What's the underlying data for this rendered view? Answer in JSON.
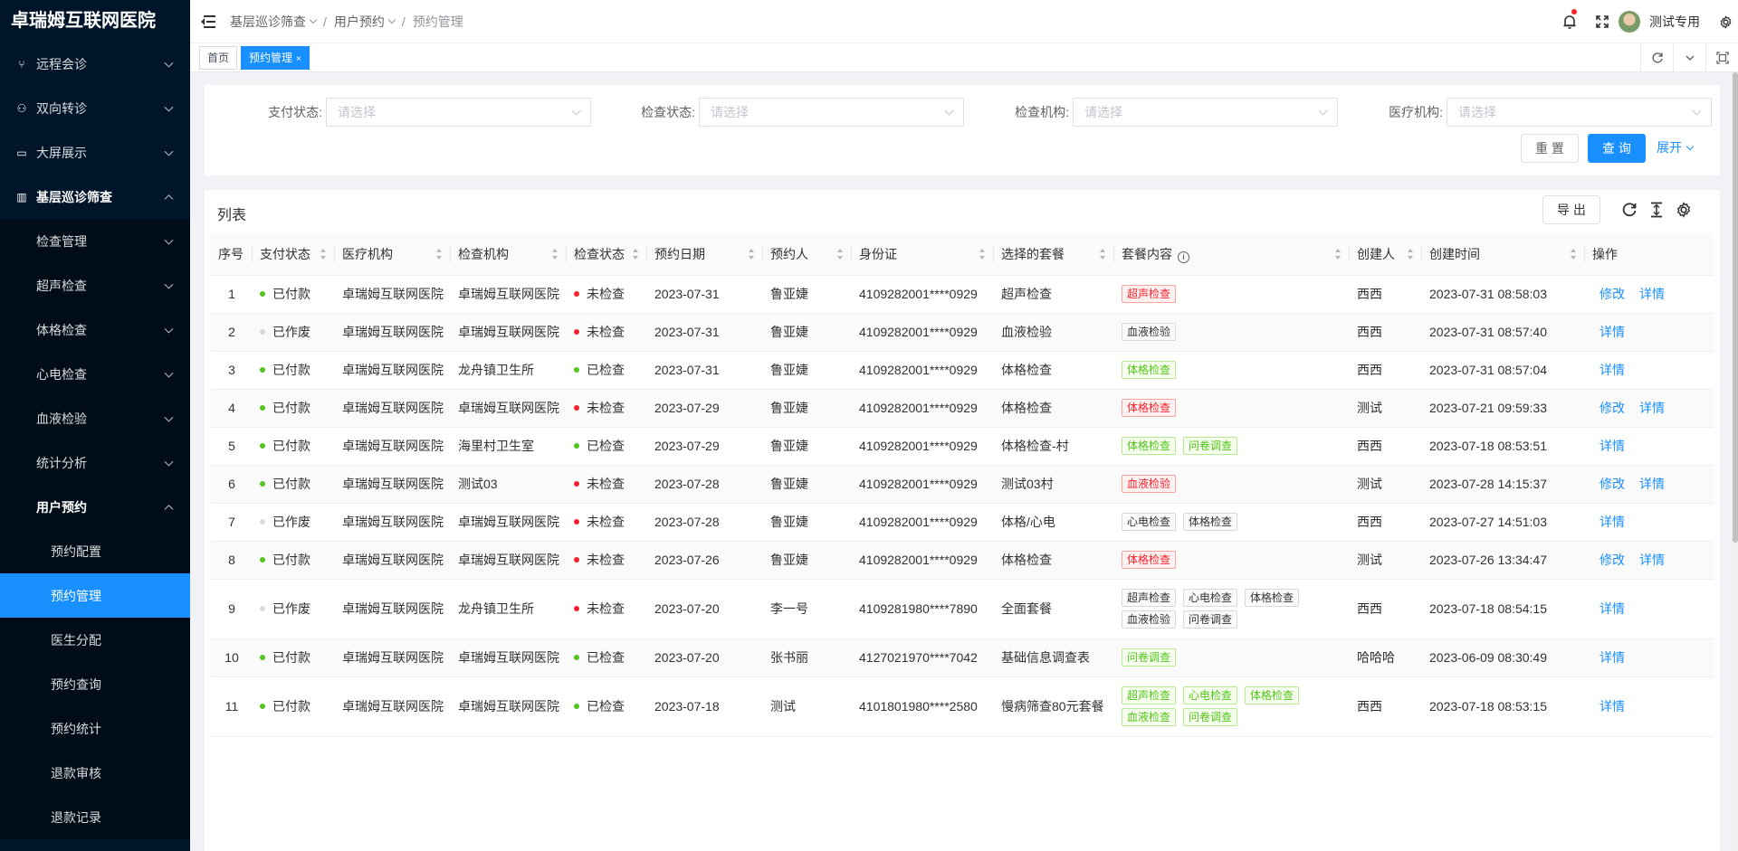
{
  "app": {
    "title": "卓瑞姆互联网医院"
  },
  "sidebar": {
    "items": [
      {
        "label": "远程会诊",
        "level": 1,
        "icon": "branch-icon",
        "open": false
      },
      {
        "label": "双向转诊",
        "level": 1,
        "icon": "share-icon",
        "open": false
      },
      {
        "label": "大屏展示",
        "level": 1,
        "icon": "screen-icon",
        "open": false
      },
      {
        "label": "基层巡诊筛查",
        "level": 1,
        "icon": "chart-icon",
        "open": true
      },
      {
        "label": "检查管理",
        "level": 2,
        "open": false
      },
      {
        "label": "超声检查",
        "level": 2,
        "open": false
      },
      {
        "label": "体格检查",
        "level": 2,
        "open": false
      },
      {
        "label": "心电检查",
        "level": 2,
        "open": false
      },
      {
        "label": "血液检验",
        "level": 2,
        "open": false
      },
      {
        "label": "统计分析",
        "level": 2,
        "open": false
      },
      {
        "label": "用户预约",
        "level": 2,
        "open": true
      },
      {
        "label": "预约配置",
        "level": 3
      },
      {
        "label": "预约管理",
        "level": 3,
        "active": true
      },
      {
        "label": "医生分配",
        "level": 3
      },
      {
        "label": "预约查询",
        "level": 3
      },
      {
        "label": "预约统计",
        "level": 3
      },
      {
        "label": "退款审核",
        "level": 3
      },
      {
        "label": "退款记录",
        "level": 3
      }
    ]
  },
  "header": {
    "breadcrumb": [
      "基层巡诊筛查",
      "用户预约",
      "预约管理"
    ],
    "username": "测试专用"
  },
  "tabs": [
    {
      "label": "首页",
      "active": false,
      "close": ""
    },
    {
      "label": "预约管理",
      "active": true,
      "close": "×"
    }
  ],
  "search": {
    "fields": [
      {
        "label": "支付状态:",
        "placeholder": "请选择"
      },
      {
        "label": "检查状态:",
        "placeholder": "请选择"
      },
      {
        "label": "检查机构:",
        "placeholder": "请选择"
      },
      {
        "label": "医疗机构:",
        "placeholder": "请选择"
      }
    ],
    "reset_label": "重 置",
    "query_label": "查 询",
    "expand_label": "展开"
  },
  "list": {
    "title": "列表",
    "export_label": "导 出",
    "columns": [
      "序号",
      "支付状态",
      "医疗机构",
      "检查机构",
      "检查状态",
      "预约日期",
      "预约人",
      "身份证",
      "选择的套餐",
      "套餐内容",
      "创建人",
      "创建时间",
      "操作"
    ],
    "rows": [
      {
        "no": "1",
        "pay": "已付款",
        "pay_color": "#52c41a",
        "org": "卓瑞姆互联网医院",
        "exam_org": "卓瑞姆互联网医院",
        "exam": "未检查",
        "exam_color": "#f5222d",
        "date": "2023-07-31",
        "person": "鲁亚婕",
        "id": "4109282001****0929",
        "package": "超声检查",
        "tags": [
          {
            "t": "超声检查",
            "c": "red"
          }
        ],
        "creator": "西西",
        "created": "2023-07-31 08:58:03",
        "ops": [
          "修改",
          "详情"
        ]
      },
      {
        "no": "2",
        "pay": "已作废",
        "pay_color": "#d9d9d9",
        "org": "卓瑞姆互联网医院",
        "exam_org": "卓瑞姆互联网医院",
        "exam": "未检查",
        "exam_color": "#f5222d",
        "date": "2023-07-31",
        "person": "鲁亚婕",
        "id": "4109282001****0929",
        "package": "血液检验",
        "tags": [
          {
            "t": "血液检验",
            "c": "gray"
          }
        ],
        "creator": "西西",
        "created": "2023-07-31 08:57:40",
        "ops": [
          "详情"
        ]
      },
      {
        "no": "3",
        "pay": "已付款",
        "pay_color": "#52c41a",
        "org": "卓瑞姆互联网医院",
        "exam_org": "龙舟镇卫生所",
        "exam": "已检查",
        "exam_color": "#52c41a",
        "date": "2023-07-31",
        "person": "鲁亚婕",
        "id": "4109282001****0929",
        "package": "体格检查",
        "tags": [
          {
            "t": "体格检查",
            "c": "green"
          }
        ],
        "creator": "西西",
        "created": "2023-07-31 08:57:04",
        "ops": [
          "详情"
        ]
      },
      {
        "no": "4",
        "pay": "已付款",
        "pay_color": "#52c41a",
        "org": "卓瑞姆互联网医院",
        "exam_org": "卓瑞姆互联网医院",
        "exam": "未检查",
        "exam_color": "#f5222d",
        "date": "2023-07-29",
        "person": "鲁亚婕",
        "id": "4109282001****0929",
        "package": "体格检查",
        "tags": [
          {
            "t": "体格检查",
            "c": "red"
          }
        ],
        "creator": "测试",
        "created": "2023-07-21 09:59:33",
        "ops": [
          "修改",
          "详情"
        ]
      },
      {
        "no": "5",
        "pay": "已付款",
        "pay_color": "#52c41a",
        "org": "卓瑞姆互联网医院",
        "exam_org": "海里村卫生室",
        "exam": "已检查",
        "exam_color": "#52c41a",
        "date": "2023-07-29",
        "person": "鲁亚婕",
        "id": "4109282001****0929",
        "package": "体格检查-村",
        "tags": [
          {
            "t": "体格检查",
            "c": "green"
          },
          {
            "t": "问卷调查",
            "c": "green"
          }
        ],
        "creator": "西西",
        "created": "2023-07-18 08:53:51",
        "ops": [
          "详情"
        ]
      },
      {
        "no": "6",
        "pay": "已付款",
        "pay_color": "#52c41a",
        "org": "卓瑞姆互联网医院",
        "exam_org": "测试03",
        "exam": "未检查",
        "exam_color": "#f5222d",
        "date": "2023-07-28",
        "person": "鲁亚婕",
        "id": "4109282001****0929",
        "package": "测试03村",
        "tags": [
          {
            "t": "血液检验",
            "c": "red"
          }
        ],
        "creator": "测试",
        "created": "2023-07-28 14:15:37",
        "ops": [
          "修改",
          "详情"
        ]
      },
      {
        "no": "7",
        "pay": "已作废",
        "pay_color": "#d9d9d9",
        "org": "卓瑞姆互联网医院",
        "exam_org": "卓瑞姆互联网医院",
        "exam": "未检查",
        "exam_color": "#f5222d",
        "date": "2023-07-28",
        "person": "鲁亚婕",
        "id": "4109282001****0929",
        "package": "体格/心电",
        "tags": [
          {
            "t": "心电检查",
            "c": "gray"
          },
          {
            "t": "体格检查",
            "c": "gray"
          }
        ],
        "creator": "西西",
        "created": "2023-07-27 14:51:03",
        "ops": [
          "详情"
        ]
      },
      {
        "no": "8",
        "pay": "已付款",
        "pay_color": "#52c41a",
        "org": "卓瑞姆互联网医院",
        "exam_org": "卓瑞姆互联网医院",
        "exam": "未检查",
        "exam_color": "#f5222d",
        "date": "2023-07-26",
        "person": "鲁亚婕",
        "id": "4109282001****0929",
        "package": "体格检查",
        "tags": [
          {
            "t": "体格检查",
            "c": "red"
          }
        ],
        "creator": "测试",
        "created": "2023-07-26 13:34:47",
        "ops": [
          "修改",
          "详情"
        ]
      },
      {
        "no": "9",
        "pay": "已作废",
        "pay_color": "#d9d9d9",
        "org": "卓瑞姆互联网医院",
        "exam_org": "龙舟镇卫生所",
        "exam": "未检查",
        "exam_color": "#f5222d",
        "date": "2023-07-20",
        "person": "李一号",
        "id": "4109281980****7890",
        "package": "全面套餐",
        "tags": [
          {
            "t": "超声检查",
            "c": "gray"
          },
          {
            "t": "心电检查",
            "c": "gray"
          },
          {
            "t": "体格检查",
            "c": "gray"
          },
          {
            "t": "血液检验",
            "c": "gray"
          },
          {
            "t": "问卷调查",
            "c": "gray"
          }
        ],
        "creator": "西西",
        "created": "2023-07-18 08:54:15",
        "ops": [
          "详情"
        ]
      },
      {
        "no": "10",
        "pay": "已付款",
        "pay_color": "#52c41a",
        "org": "卓瑞姆互联网医院",
        "exam_org": "卓瑞姆互联网医院",
        "exam": "已检查",
        "exam_color": "#52c41a",
        "date": "2023-07-20",
        "person": "张书丽",
        "id": "4127021970****7042",
        "package": "基础信息调查表",
        "tags": [
          {
            "t": "问卷调查",
            "c": "green"
          }
        ],
        "creator": "哈哈哈",
        "created": "2023-06-09 08:30:49",
        "ops": [
          "详情"
        ]
      },
      {
        "no": "11",
        "pay": "已付款",
        "pay_color": "#52c41a",
        "org": "卓瑞姆互联网医院",
        "exam_org": "卓瑞姆互联网医院",
        "exam": "已检查",
        "exam_color": "#52c41a",
        "date": "2023-07-18",
        "person": "测试",
        "id": "4101801980****2580",
        "package": "慢病筛查80元套餐",
        "tags": [
          {
            "t": "超声检查",
            "c": "green"
          },
          {
            "t": "心电检查",
            "c": "green"
          },
          {
            "t": "体格检查",
            "c": "green"
          },
          {
            "t": "血液检查",
            "c": "green"
          },
          {
            "t": "问卷调查",
            "c": "green"
          }
        ],
        "creator": "西西",
        "created": "2023-07-18 08:53:15",
        "ops": [
          "详情"
        ]
      }
    ]
  }
}
